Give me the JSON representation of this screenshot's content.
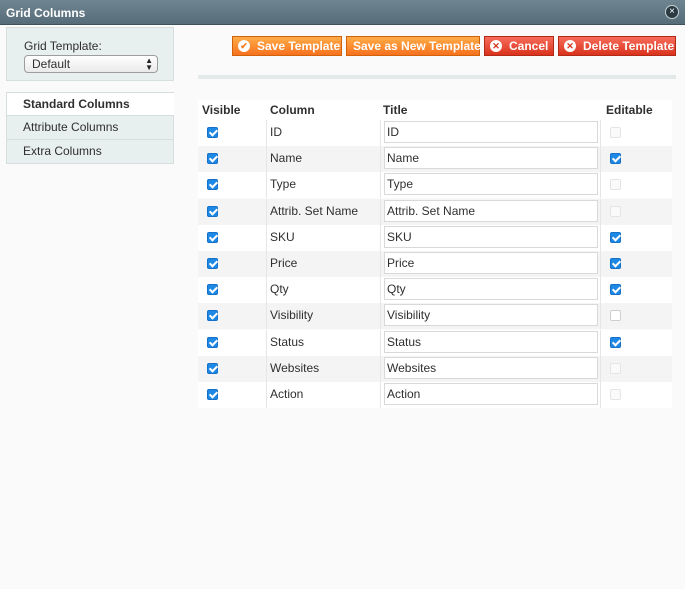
{
  "window": {
    "title": "Grid Columns",
    "close_glyph": "×"
  },
  "template": {
    "label": "Grid Template:",
    "selected": "Default"
  },
  "tabs": [
    {
      "label": "Standard Columns",
      "active": true
    },
    {
      "label": "Attribute Columns",
      "active": false
    },
    {
      "label": "Extra Columns",
      "active": false
    }
  ],
  "buttons": {
    "save": "Save Template",
    "save_new": "Save as New Template",
    "cancel": "Cancel",
    "delete": "Delete Template"
  },
  "grid": {
    "headers": {
      "visible": "Visible",
      "column": "Column",
      "title": "Title",
      "editable": "Editable"
    },
    "rows": [
      {
        "column": "ID",
        "title": "ID",
        "visible": true,
        "editable": "disabled"
      },
      {
        "column": "Name",
        "title": "Name",
        "visible": true,
        "editable": "on"
      },
      {
        "column": "Type",
        "title": "Type",
        "visible": true,
        "editable": "disabled"
      },
      {
        "column": "Attrib. Set Name",
        "title": "Attrib. Set Name",
        "visible": true,
        "editable": "disabled"
      },
      {
        "column": "SKU",
        "title": "SKU",
        "visible": true,
        "editable": "on"
      },
      {
        "column": "Price",
        "title": "Price",
        "visible": true,
        "editable": "on"
      },
      {
        "column": "Qty",
        "title": "Qty",
        "visible": true,
        "editable": "on"
      },
      {
        "column": "Visibility",
        "title": "Visibility",
        "visible": true,
        "editable": "off"
      },
      {
        "column": "Status",
        "title": "Status",
        "visible": true,
        "editable": "on"
      },
      {
        "column": "Websites",
        "title": "Websites",
        "visible": true,
        "editable": "disabled"
      },
      {
        "column": "Action",
        "title": "Action",
        "visible": true,
        "editable": "disabled"
      }
    ]
  },
  "colors": {
    "accent_orange": "#f7711f",
    "accent_red": "#d9321d",
    "checkbox_blue": "#1e88e5",
    "titlebar": "#5f7480"
  }
}
